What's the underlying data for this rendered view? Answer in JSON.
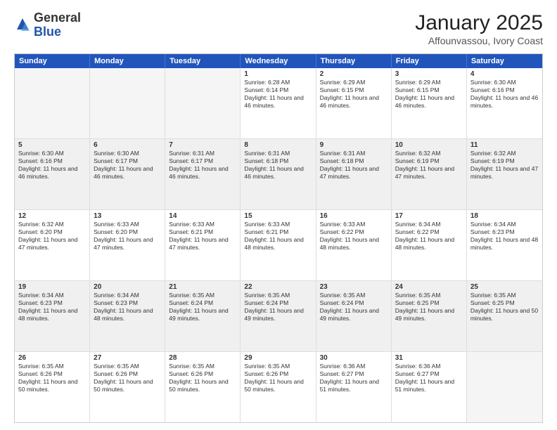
{
  "header": {
    "logo_general": "General",
    "logo_blue": "Blue",
    "month_title": "January 2025",
    "location": "Affounvassou, Ivory Coast"
  },
  "calendar": {
    "days_of_week": [
      "Sunday",
      "Monday",
      "Tuesday",
      "Wednesday",
      "Thursday",
      "Friday",
      "Saturday"
    ],
    "weeks": [
      [
        {
          "day": "",
          "empty": true
        },
        {
          "day": "",
          "empty": true
        },
        {
          "day": "",
          "empty": true
        },
        {
          "day": "1",
          "sunrise": "Sunrise: 6:28 AM",
          "sunset": "Sunset: 6:14 PM",
          "daylight": "Daylight: 11 hours and 46 minutes."
        },
        {
          "day": "2",
          "sunrise": "Sunrise: 6:29 AM",
          "sunset": "Sunset: 6:15 PM",
          "daylight": "Daylight: 11 hours and 46 minutes."
        },
        {
          "day": "3",
          "sunrise": "Sunrise: 6:29 AM",
          "sunset": "Sunset: 6:15 PM",
          "daylight": "Daylight: 11 hours and 46 minutes."
        },
        {
          "day": "4",
          "sunrise": "Sunrise: 6:30 AM",
          "sunset": "Sunset: 6:16 PM",
          "daylight": "Daylight: 11 hours and 46 minutes."
        }
      ],
      [
        {
          "day": "5",
          "sunrise": "Sunrise: 6:30 AM",
          "sunset": "Sunset: 6:16 PM",
          "daylight": "Daylight: 11 hours and 46 minutes."
        },
        {
          "day": "6",
          "sunrise": "Sunrise: 6:30 AM",
          "sunset": "Sunset: 6:17 PM",
          "daylight": "Daylight: 11 hours and 46 minutes."
        },
        {
          "day": "7",
          "sunrise": "Sunrise: 6:31 AM",
          "sunset": "Sunset: 6:17 PM",
          "daylight": "Daylight: 11 hours and 46 minutes."
        },
        {
          "day": "8",
          "sunrise": "Sunrise: 6:31 AM",
          "sunset": "Sunset: 6:18 PM",
          "daylight": "Daylight: 11 hours and 46 minutes."
        },
        {
          "day": "9",
          "sunrise": "Sunrise: 6:31 AM",
          "sunset": "Sunset: 6:18 PM",
          "daylight": "Daylight: 11 hours and 47 minutes."
        },
        {
          "day": "10",
          "sunrise": "Sunrise: 6:32 AM",
          "sunset": "Sunset: 6:19 PM",
          "daylight": "Daylight: 11 hours and 47 minutes."
        },
        {
          "day": "11",
          "sunrise": "Sunrise: 6:32 AM",
          "sunset": "Sunset: 6:19 PM",
          "daylight": "Daylight: 11 hours and 47 minutes."
        }
      ],
      [
        {
          "day": "12",
          "sunrise": "Sunrise: 6:32 AM",
          "sunset": "Sunset: 6:20 PM",
          "daylight": "Daylight: 11 hours and 47 minutes."
        },
        {
          "day": "13",
          "sunrise": "Sunrise: 6:33 AM",
          "sunset": "Sunset: 6:20 PM",
          "daylight": "Daylight: 11 hours and 47 minutes."
        },
        {
          "day": "14",
          "sunrise": "Sunrise: 6:33 AM",
          "sunset": "Sunset: 6:21 PM",
          "daylight": "Daylight: 11 hours and 47 minutes."
        },
        {
          "day": "15",
          "sunrise": "Sunrise: 6:33 AM",
          "sunset": "Sunset: 6:21 PM",
          "daylight": "Daylight: 11 hours and 48 minutes."
        },
        {
          "day": "16",
          "sunrise": "Sunrise: 6:33 AM",
          "sunset": "Sunset: 6:22 PM",
          "daylight": "Daylight: 11 hours and 48 minutes."
        },
        {
          "day": "17",
          "sunrise": "Sunrise: 6:34 AM",
          "sunset": "Sunset: 6:22 PM",
          "daylight": "Daylight: 11 hours and 48 minutes."
        },
        {
          "day": "18",
          "sunrise": "Sunrise: 6:34 AM",
          "sunset": "Sunset: 6:23 PM",
          "daylight": "Daylight: 11 hours and 48 minutes."
        }
      ],
      [
        {
          "day": "19",
          "sunrise": "Sunrise: 6:34 AM",
          "sunset": "Sunset: 6:23 PM",
          "daylight": "Daylight: 11 hours and 48 minutes."
        },
        {
          "day": "20",
          "sunrise": "Sunrise: 6:34 AM",
          "sunset": "Sunset: 6:23 PM",
          "daylight": "Daylight: 11 hours and 48 minutes."
        },
        {
          "day": "21",
          "sunrise": "Sunrise: 6:35 AM",
          "sunset": "Sunset: 6:24 PM",
          "daylight": "Daylight: 11 hours and 49 minutes."
        },
        {
          "day": "22",
          "sunrise": "Sunrise: 6:35 AM",
          "sunset": "Sunset: 6:24 PM",
          "daylight": "Daylight: 11 hours and 49 minutes."
        },
        {
          "day": "23",
          "sunrise": "Sunrise: 6:35 AM",
          "sunset": "Sunset: 6:24 PM",
          "daylight": "Daylight: 11 hours and 49 minutes."
        },
        {
          "day": "24",
          "sunrise": "Sunrise: 6:35 AM",
          "sunset": "Sunset: 6:25 PM",
          "daylight": "Daylight: 11 hours and 49 minutes."
        },
        {
          "day": "25",
          "sunrise": "Sunrise: 6:35 AM",
          "sunset": "Sunset: 6:25 PM",
          "daylight": "Daylight: 11 hours and 50 minutes."
        }
      ],
      [
        {
          "day": "26",
          "sunrise": "Sunrise: 6:35 AM",
          "sunset": "Sunset: 6:26 PM",
          "daylight": "Daylight: 11 hours and 50 minutes."
        },
        {
          "day": "27",
          "sunrise": "Sunrise: 6:35 AM",
          "sunset": "Sunset: 6:26 PM",
          "daylight": "Daylight: 11 hours and 50 minutes."
        },
        {
          "day": "28",
          "sunrise": "Sunrise: 6:35 AM",
          "sunset": "Sunset: 6:26 PM",
          "daylight": "Daylight: 11 hours and 50 minutes."
        },
        {
          "day": "29",
          "sunrise": "Sunrise: 6:35 AM",
          "sunset": "Sunset: 6:26 PM",
          "daylight": "Daylight: 11 hours and 50 minutes."
        },
        {
          "day": "30",
          "sunrise": "Sunrise: 6:36 AM",
          "sunset": "Sunset: 6:27 PM",
          "daylight": "Daylight: 11 hours and 51 minutes."
        },
        {
          "day": "31",
          "sunrise": "Sunrise: 6:36 AM",
          "sunset": "Sunset: 6:27 PM",
          "daylight": "Daylight: 11 hours and 51 minutes."
        },
        {
          "day": "",
          "empty": true
        }
      ]
    ]
  }
}
